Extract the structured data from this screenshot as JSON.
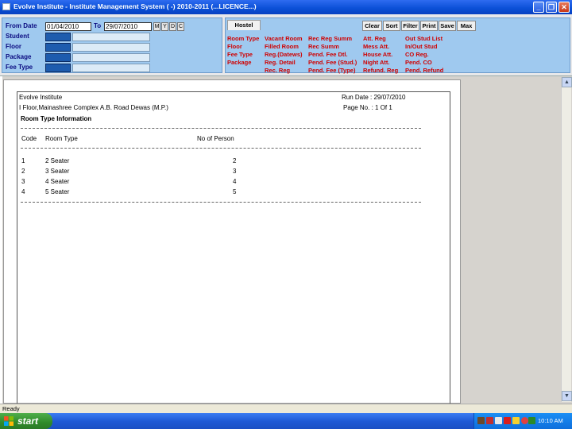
{
  "window": {
    "title": "Evolve Institute - Institute Management System ( -) 2010-2011 (...LICENCE...)",
    "controls": {
      "minimize": "_",
      "maximize": "❐",
      "close": "✕"
    }
  },
  "filters": {
    "from_date_label": "From Date",
    "from_date": "01/04/2010",
    "to_label": "To",
    "to_date": "29/07/2010",
    "period_buttons": [
      "M",
      "Y",
      "D",
      "C"
    ],
    "rows": [
      {
        "label": "Student"
      },
      {
        "label": "Floor"
      },
      {
        "label": "Package"
      },
      {
        "label": "Fee Type"
      }
    ]
  },
  "hostel": {
    "tab": "Hostel",
    "buttons": [
      "Clear",
      "Sort",
      "Filter",
      "Print",
      "Save",
      "Max"
    ],
    "report_columns": [
      [
        "Room Type",
        "Floor",
        "Fee Type",
        "Package"
      ],
      [
        "Vacant Room",
        "Filled Room",
        "Reg.(Datews)",
        "Reg. Detail",
        "Rec. Reg"
      ],
      [
        "Rec Reg Summ",
        "Rec Summ",
        "Pend. Fee Dtl.",
        "Pend. Fee (Stud.)",
        "Pend. Fee (Type)"
      ],
      [
        "Att. Reg",
        "Mess Att.",
        "House Att.",
        "Night Att.",
        "Refund. Reg"
      ],
      [
        "Out Stud List",
        "In/Out Stud",
        "CO Reg.",
        "Pend. CO",
        "Pend. Refund"
      ]
    ]
  },
  "report": {
    "institute": "Evolve Institute",
    "address": "I Floor,Mainashree Complex A.B. Road Dewas (M.P.)",
    "run_date": "Run Date : 29/07/2010",
    "page_no": "Page No. : 1 Of 1",
    "title": "Room Type Information",
    "columns": {
      "code": "Code",
      "room_type": "Room Type",
      "persons": "No of Person"
    },
    "rows": [
      {
        "code": "1",
        "room_type": "2 Seater",
        "persons": "2"
      },
      {
        "code": "2",
        "room_type": "3 Seater",
        "persons": "3"
      },
      {
        "code": "3",
        "room_type": "4 Seater",
        "persons": "4"
      },
      {
        "code": "4",
        "room_type": "5 Seater",
        "persons": "5"
      }
    ]
  },
  "scrollbar": {
    "up": "▲",
    "down": "▼"
  },
  "status": {
    "text": "Ready"
  },
  "taskbar": {
    "start": "start",
    "clock": "10:10 AM"
  }
}
